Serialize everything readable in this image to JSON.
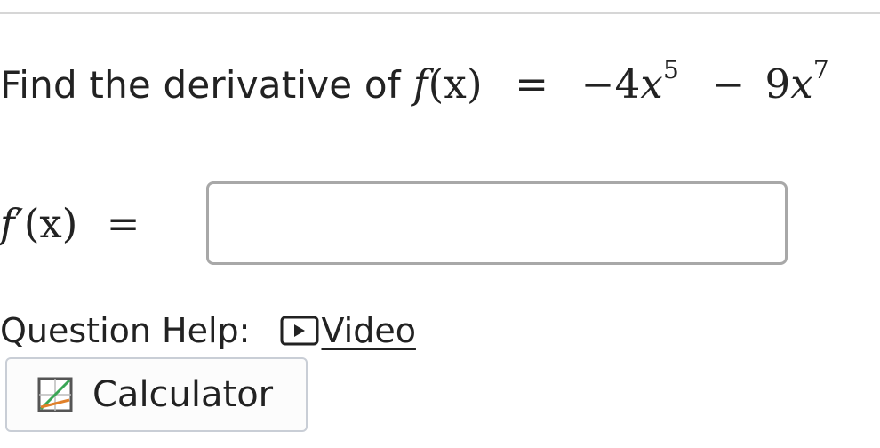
{
  "question": {
    "prompt": "Find the derivative of",
    "function_lhs_name": "f",
    "function_lhs_arg": "(x)",
    "equals": "=",
    "term1_sign": "−",
    "term1_coef": "4",
    "term1_var": "x",
    "term1_exp": "5",
    "term2_sign": "−",
    "term2_coef": "9",
    "term2_var": "x",
    "term2_exp": "7"
  },
  "answer": {
    "label_name": "f",
    "label_prime": "′",
    "label_arg": "(x)",
    "label_equals": "=",
    "value": ""
  },
  "help": {
    "label": "Question Help:",
    "video_label": "Video",
    "calculator_label": "Calculator"
  },
  "icons": {
    "video": "play-icon",
    "calculator": "calculator-icon"
  }
}
